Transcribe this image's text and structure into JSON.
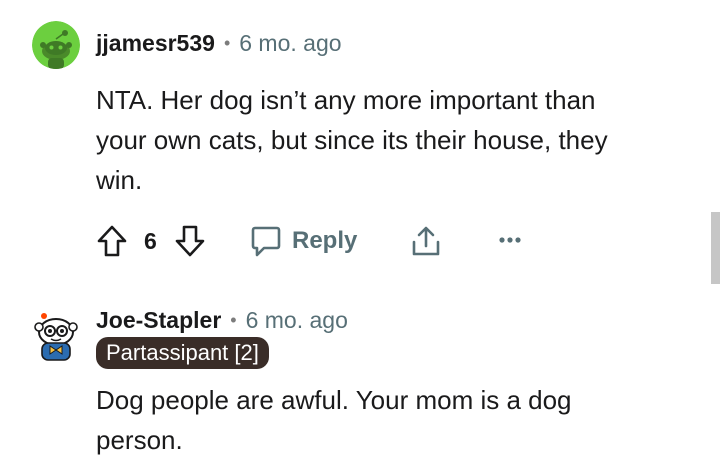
{
  "comments": [
    {
      "author": "jjamesr539",
      "separator": "•",
      "time": "6 mo. ago",
      "lines": [
        "NTA. Her dog isn’t any more important than",
        "your own cats, but since its their house, they",
        "win."
      ],
      "votes": "6",
      "reply_label": "Reply",
      "avatar": "green-snoo-avatar",
      "avatar_color": "#6ccf3f"
    },
    {
      "author": "Joe-Stapler",
      "separator": "•",
      "time": "6 mo. ago",
      "flair": "Partassipant [2]",
      "lines": [
        "Dog people are awful. Your mom is a dog",
        "person."
      ],
      "avatar": "snoo-with-bowtie-avatar"
    }
  ],
  "icons": {
    "upvote": "arrow-up-icon",
    "downvote": "arrow-down-icon",
    "reply": "speech-bubble-icon",
    "share": "share-icon",
    "more": "more-dots-icon"
  },
  "colors": {
    "text": "#1a1a1b",
    "meta": "#576f76",
    "flair_bg": "#3a2d28",
    "avatar_green": "#6ccf3f"
  }
}
